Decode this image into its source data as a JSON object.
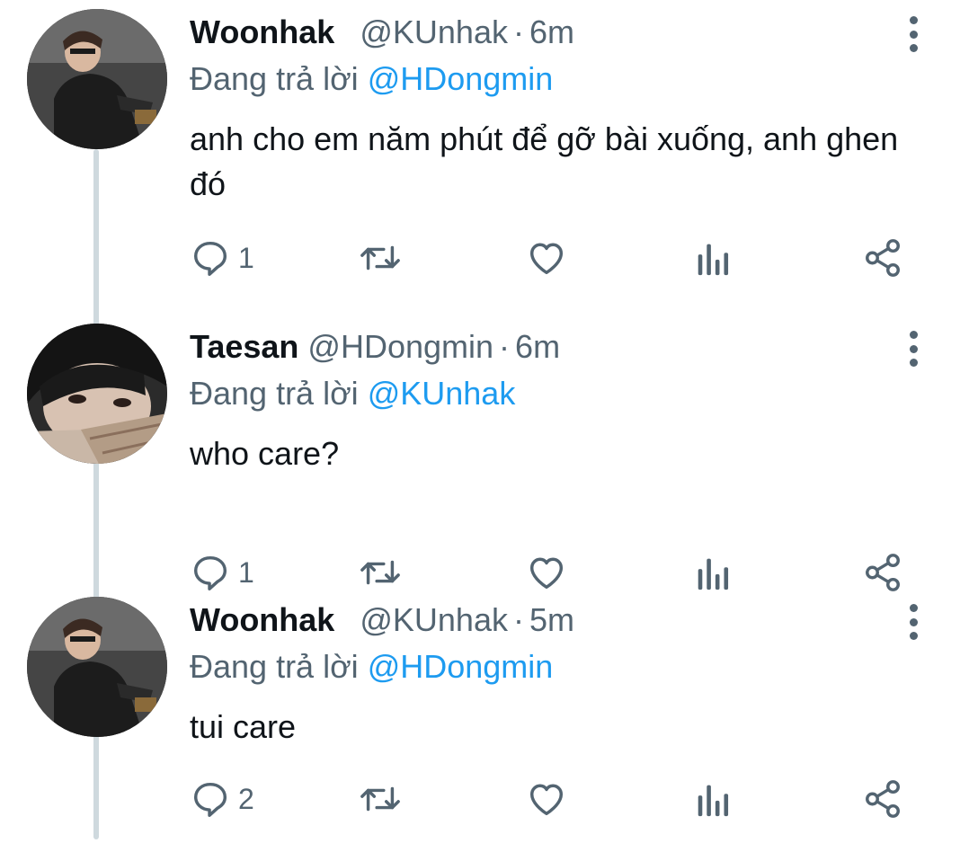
{
  "thread": {
    "reply_prefix": "Đang trả lời",
    "tweets": [
      {
        "name": "Woonhak",
        "handle": "@KUnhak",
        "separator": "·",
        "time": "6m",
        "reply_to": "@HDongmin",
        "text": "anh cho em năm phút để gỡ bài xuống, anh ghen đó",
        "reply_count": "1"
      },
      {
        "name": "Taesan",
        "handle": "@HDongmin",
        "separator": "·",
        "time": "6m",
        "reply_to": "@KUnhak",
        "text": "who care?",
        "reply_count": "1"
      },
      {
        "name": "Woonhak",
        "handle": "@KUnhak",
        "separator": "·",
        "time": "5m",
        "reply_to": "@HDongmin",
        "text": "tui care",
        "reply_count": "2"
      }
    ]
  },
  "icons": {
    "reply": "speech-bubble-icon",
    "retweet": "retweet-icon",
    "like": "heart-icon",
    "views": "bar-chart-icon",
    "share": "share-icon",
    "more": "vertical-dots-icon"
  },
  "colors": {
    "mention": "#1d9bf0",
    "secondary_text": "#536471",
    "primary_text": "#0f1419",
    "thread_line": "#cfd9de"
  }
}
